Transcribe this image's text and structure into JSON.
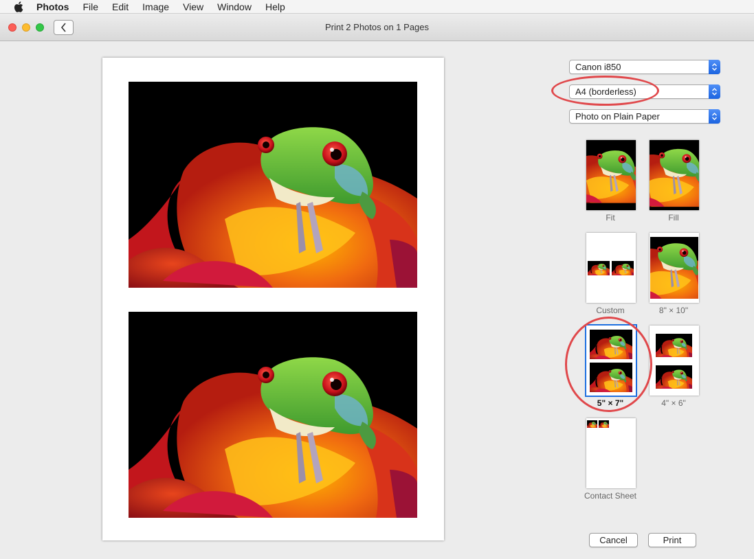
{
  "menubar": {
    "apple_icon": "apple-logo-icon",
    "items": [
      "Photos",
      "File",
      "Edit",
      "Image",
      "View",
      "Window",
      "Help"
    ]
  },
  "window": {
    "title": "Print 2 Photos on 1 Pages",
    "back_icon": "chevron-left-icon"
  },
  "print_settings": {
    "printer": "Canon i850",
    "paper_size": "A4 (borderless)",
    "media_type": "Photo on Plain Paper"
  },
  "layouts": [
    {
      "label": "Fit",
      "selected": false
    },
    {
      "label": "Fill",
      "selected": false
    },
    {
      "label": "Custom",
      "selected": false
    },
    {
      "label": "8\" × 10\"",
      "selected": false
    },
    {
      "label": "5\" × 7\"",
      "selected": true
    },
    {
      "label": "4\" × 6\"",
      "selected": false
    },
    {
      "label": "Contact Sheet",
      "selected": false
    }
  ],
  "buttons": {
    "cancel": "Cancel",
    "print": "Print"
  },
  "colors": {
    "selection_blue": "#1e6fe0",
    "annotation_red": "#e0484b",
    "popup_stepper_blue": "#1c64e0"
  }
}
